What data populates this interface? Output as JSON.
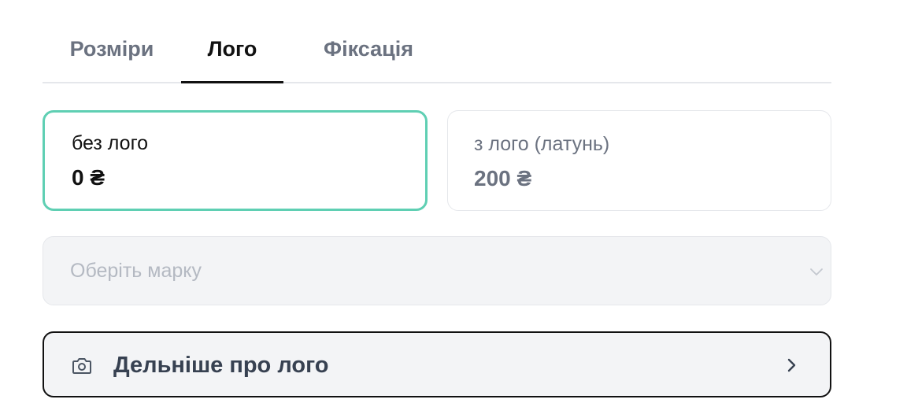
{
  "tabs": [
    {
      "label": "Розміри",
      "active": false
    },
    {
      "label": "Лого",
      "active": true
    },
    {
      "label": "Фіксація",
      "active": false
    }
  ],
  "logo_options": [
    {
      "label": "без лого",
      "price": "0 ₴",
      "selected": true
    },
    {
      "label": "з лого (латунь)",
      "price": "200 ₴",
      "selected": false
    }
  ],
  "brand_select": {
    "placeholder": "Оберіть марку",
    "disabled": true
  },
  "more_button": {
    "label": "Дельніше про лого",
    "icon": "camera-icon",
    "arrow_icon": "chevron-right-icon"
  },
  "colors": {
    "selected_border": "#5fcfb3",
    "active_tab": "#111111",
    "inactive_tab": "#6b7280"
  }
}
